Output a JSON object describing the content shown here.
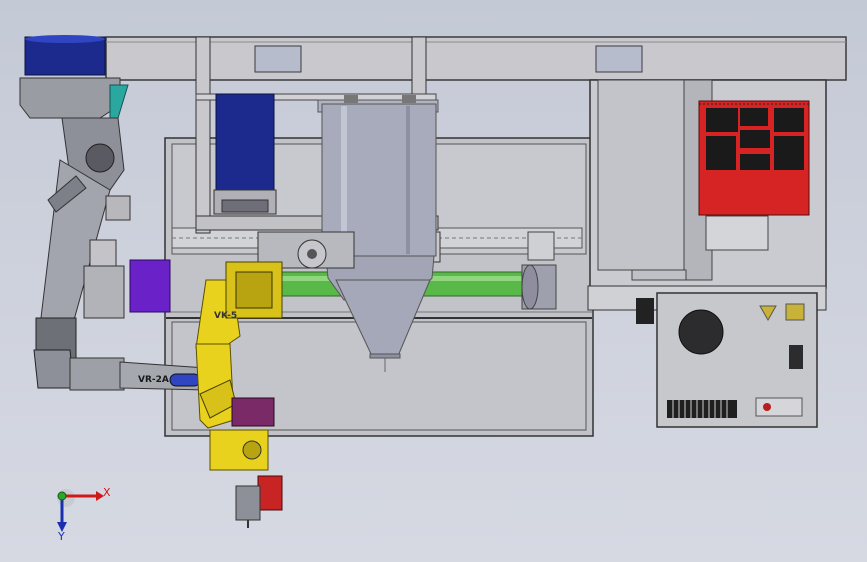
{
  "viewport": {
    "background": "#cdd1dc"
  },
  "colors": {
    "frame": "#c8c8cc",
    "frame_dark": "#4a4a4e",
    "robot_gray": "#9a9ca4",
    "robot_yellow": "#e9d21e",
    "motor_blue": "#1b2a8c",
    "purple": "#6a22c8",
    "green_shaft": "#58b848",
    "hopper": "#a4a8b8",
    "cabinet_red": "#d62424",
    "cabinet_panel": "#c6c8cc",
    "teal": "#2aa8a0",
    "axis_x": "#d01818",
    "axis_y": "#1a2fb0",
    "axis_z": "#2aa82a"
  },
  "robots": {
    "large_label": "VR-2A",
    "small_label": "VK-5"
  },
  "axis_triad": {
    "x_label": "X",
    "y_label": "Y"
  }
}
